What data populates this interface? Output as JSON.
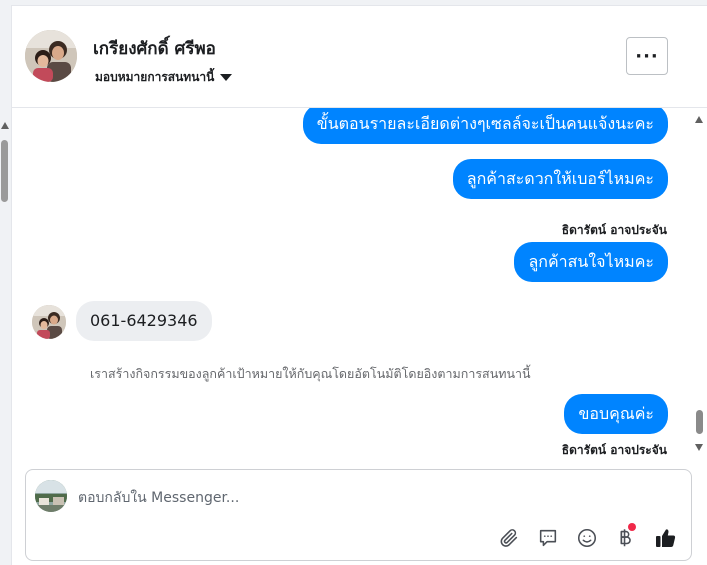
{
  "header": {
    "contact_name": "เกรียงศักดิ์ ศรีพอ",
    "assign_label": "มอบหมายการสนทนานี้",
    "more_label": "···"
  },
  "messages": [
    {
      "direction": "out",
      "text": "ขั้นตอนรายละเอียดต่างๆเซลล์จะเป็นคนแจ้งนะคะ"
    },
    {
      "direction": "out",
      "text": "ลูกค้าสะดวกให้เบอร์ไหมคะ"
    },
    {
      "direction": "out",
      "sender": "ธิดารัตน์ อาจประจัน",
      "text": "ลูกค้าสนใจไหมคะ"
    },
    {
      "direction": "in",
      "text": "061-6429346"
    },
    {
      "direction": "system",
      "text": "เราสร้างกิจกรรมของลูกค้าเป้าหมายให้กับคุณโดยอัตโนมัติโดยอิงตามการสนทนานี้"
    },
    {
      "direction": "out",
      "text": "ขอบคุณค่ะ",
      "sender_after": "ธิดารัตน์ อาจประจัน"
    }
  ],
  "composer": {
    "placeholder": "ตอบกลับใน Messenger..."
  },
  "icons": {
    "attach": "paperclip-icon",
    "saved_replies": "chat-bubble-icon",
    "emoji": "smiley-icon",
    "payment": "baht-icon",
    "like": "thumbs-up-icon"
  },
  "colors": {
    "outgoing_bubble": "#0084ff",
    "incoming_bubble": "#eceef1",
    "notification_dot": "#f02849"
  }
}
